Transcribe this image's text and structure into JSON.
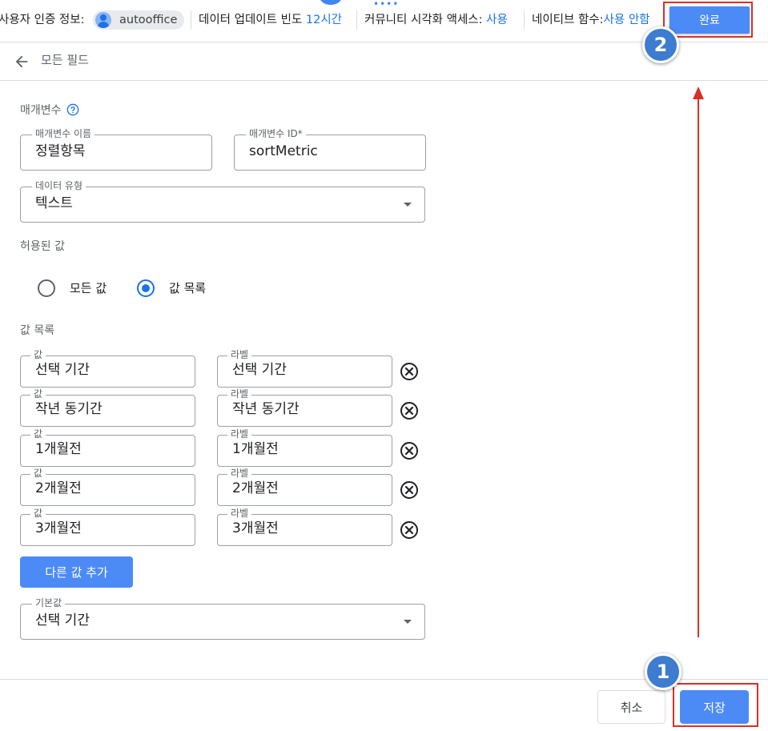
{
  "topbar": {
    "credentials_label": "사용자 인증 정보:",
    "credentials_user": "autooffice",
    "freshness_label": "데이터 업데이트 빈도",
    "freshness_value": "12시간",
    "community_label": "커뮤니티 시각화 액세스:",
    "community_value": "사용",
    "native_label": "네이티브 함수:",
    "native_value": "사용 안함",
    "done_label": "완료"
  },
  "header": {
    "title": "모든 필드"
  },
  "param": {
    "section_label": "매개변수",
    "name_label": "매개변수 이름",
    "name_value": "정렬항목",
    "id_label": "매개변수 ID*",
    "id_value": "sortMetric",
    "type_label": "데이터 유형",
    "type_value": "텍스트",
    "allowed_label": "허용된 값",
    "options": [
      "모든 값",
      "값 목록"
    ],
    "selected_option": "값 목록",
    "list_label": "값 목록",
    "value_col": "값",
    "label_col": "라벨",
    "rows": [
      {
        "value": "선택 기간",
        "label": "선택 기간"
      },
      {
        "value": "작년 동기간",
        "label": "작년 동기간"
      },
      {
        "value": "1개월전",
        "label": "1개월전"
      },
      {
        "value": "2개월전",
        "label": "2개월전"
      },
      {
        "value": "3개월전",
        "label": "3개월전"
      }
    ],
    "add_label": "다른 값 추가",
    "default_label": "기본값",
    "default_value": "선택 기간"
  },
  "footer": {
    "cancel_label": "취소",
    "save_label": "저장"
  },
  "annotations": {
    "step1": "1",
    "step2": "2",
    "highlight_color": "#d93025",
    "badge_color": "#3d7ccf"
  },
  "colors": {
    "accent": "#4c8bf5",
    "link": "#1a73e8"
  }
}
